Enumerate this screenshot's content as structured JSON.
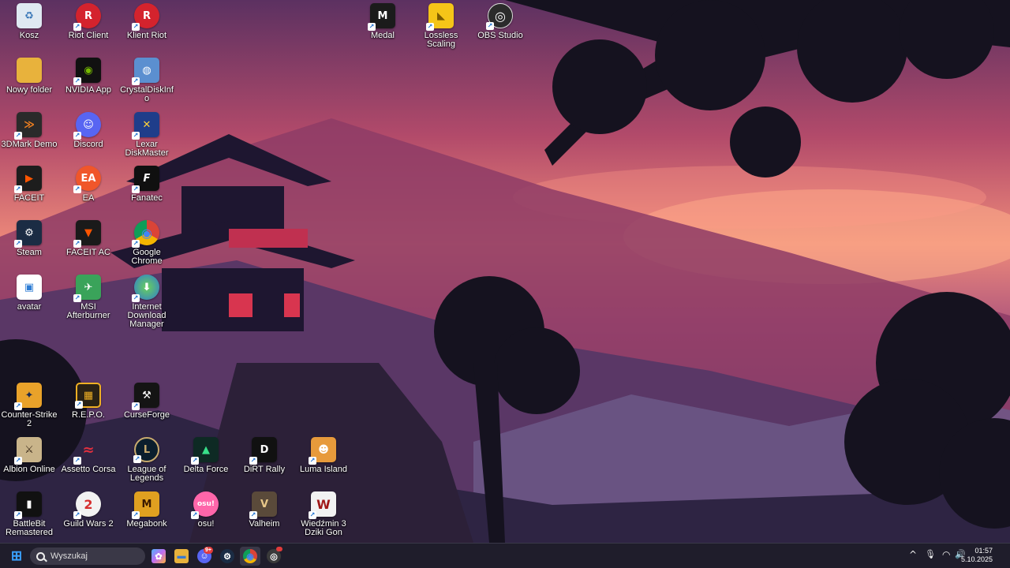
{
  "desktop_icons": [
    {
      "label": "Kosz",
      "icon": "recycle-bin-icon",
      "color": "#6aa7d8",
      "glyph": "♻"
    },
    {
      "label": "Riot Client",
      "icon": "riot-client-icon",
      "color": "#d4232d",
      "glyph": "R"
    },
    {
      "label": "Klient Riot",
      "icon": "riot-client-icon",
      "color": "#d4232d",
      "glyph": "R"
    },
    {
      "label": "Medal",
      "icon": "medal-icon",
      "color": "#1b1b1b",
      "glyph": "M"
    },
    {
      "label": "Lossless Scaling",
      "icon": "duck-icon",
      "color": "#f5c518",
      "glyph": "◣"
    },
    {
      "label": "OBS Studio",
      "icon": "obs-icon",
      "color": "#2b2b2b",
      "glyph": "◎"
    },
    {
      "label": "Nowy folder",
      "icon": "folder-icon",
      "color": "#e8b23c",
      "glyph": ""
    },
    {
      "label": "NVIDIA App",
      "icon": "nvidia-icon",
      "color": "#111111",
      "glyph": "◉"
    },
    {
      "label": "CrystalDiskInfo",
      "icon": "disk-icon",
      "color": "#5b8fd0",
      "glyph": "◍"
    },
    {
      "label": "3DMark Demo",
      "icon": "3dmark-icon",
      "color": "#2a2a2a",
      "glyph": "≫"
    },
    {
      "label": "Discord",
      "icon": "discord-icon",
      "color": "#5865f2",
      "glyph": "☺"
    },
    {
      "label": "Lexar DiskMaster",
      "icon": "lexar-icon",
      "color": "#1f3d8a",
      "glyph": "✕"
    },
    {
      "label": "FACEIT",
      "icon": "faceit-icon",
      "color": "#1d1d1d",
      "glyph": "▶"
    },
    {
      "label": "EA",
      "icon": "ea-icon",
      "color": "#f0562a",
      "glyph": "EA"
    },
    {
      "label": "Fanatec",
      "icon": "fanatec-icon",
      "color": "#101010",
      "glyph": "F"
    },
    {
      "label": "Steam",
      "icon": "steam-icon",
      "color": "#1b2c44",
      "glyph": "⚙"
    },
    {
      "label": "FACEIT AC",
      "icon": "faceit-ac-icon",
      "color": "#1a1a1a",
      "glyph": "▼"
    },
    {
      "label": "Google Chrome",
      "icon": "chrome-icon",
      "color": "#e8b23c",
      "glyph": "◉"
    },
    {
      "label": "avatar",
      "icon": "image-file-icon",
      "color": "#ffffff",
      "glyph": "▣"
    },
    {
      "label": "MSI Afterburner",
      "icon": "afterburner-icon",
      "color": "#3aa35a",
      "glyph": "✈"
    },
    {
      "label": "Internet Download Manager",
      "icon": "idm-icon",
      "color": "#2f7bd1",
      "glyph": "⬇"
    },
    {
      "label": "Counter-Strike 2",
      "icon": "cs2-icon",
      "color": "#e9a22a",
      "glyph": "✦"
    },
    {
      "label": "R.E.P.O.",
      "icon": "repo-icon",
      "color": "#f0b024",
      "glyph": "▦"
    },
    {
      "label": "CurseForge",
      "icon": "curseforge-icon",
      "color": "#141414",
      "glyph": "⚒"
    },
    {
      "label": "Albion Online",
      "icon": "albion-icon",
      "color": "#c9b48a",
      "glyph": "⚔"
    },
    {
      "label": "Assetto Corsa",
      "icon": "assetto-icon",
      "color": "#c92030",
      "glyph": "≈"
    },
    {
      "label": "League of Legends",
      "icon": "lol-icon",
      "color": "#0b1e2d",
      "glyph": "L"
    },
    {
      "label": "Delta Force",
      "icon": "delta-force-icon",
      "color": "#0e2a24",
      "glyph": "▲"
    },
    {
      "label": "DiRT Rally",
      "icon": "dirt-icon",
      "color": "#111111",
      "glyph": "D"
    },
    {
      "label": "Luma Island",
      "icon": "luma-icon",
      "color": "#e79a3b",
      "glyph": "☻"
    },
    {
      "label": "BattleBit Remastered",
      "icon": "battlebit-icon",
      "color": "#111111",
      "glyph": "▮"
    },
    {
      "label": "Guild Wars 2",
      "icon": "gw2-icon",
      "color": "#d62f2f",
      "glyph": "2"
    },
    {
      "label": "Megabonk",
      "icon": "megabonk-icon",
      "color": "#e0a020",
      "glyph": "M"
    },
    {
      "label": "osu!",
      "icon": "osu-icon",
      "color": "#ff66aa",
      "glyph": "osu!"
    },
    {
      "label": "Valheim",
      "icon": "valheim-icon",
      "color": "#5a4a3a",
      "glyph": "V"
    },
    {
      "label": "Wiedźmin 3 Dziki Gon",
      "icon": "witcher-icon",
      "color": "#f2f2f2",
      "glyph": "W"
    }
  ],
  "taskbar": {
    "search_placeholder": "Wyszukaj",
    "apps": [
      {
        "icon": "start-icon",
        "color": "#3aa0ff",
        "glyph": "⊞"
      },
      {
        "icon": "copilot-icon",
        "color": "#8a6cf0",
        "glyph": "✿"
      },
      {
        "icon": "file-explorer-icon",
        "color": "#e8b23c",
        "glyph": "▬"
      },
      {
        "icon": "discord-icon",
        "color": "#5865f2",
        "glyph": "☺",
        "badge": "9+"
      },
      {
        "icon": "steam-icon",
        "color": "#1b2c44",
        "glyph": "⚙"
      },
      {
        "icon": "chrome-icon",
        "color": "#2a8a3a",
        "glyph": "◉"
      },
      {
        "icon": "obs-icon",
        "color": "#3a3a3a",
        "glyph": "◎",
        "badge": "•"
      }
    ],
    "tray": {
      "chevron": "^",
      "mic": "🎙",
      "wifi": "◠",
      "volume": "🔊",
      "time": "01:57",
      "date": "5.10.2025"
    }
  }
}
